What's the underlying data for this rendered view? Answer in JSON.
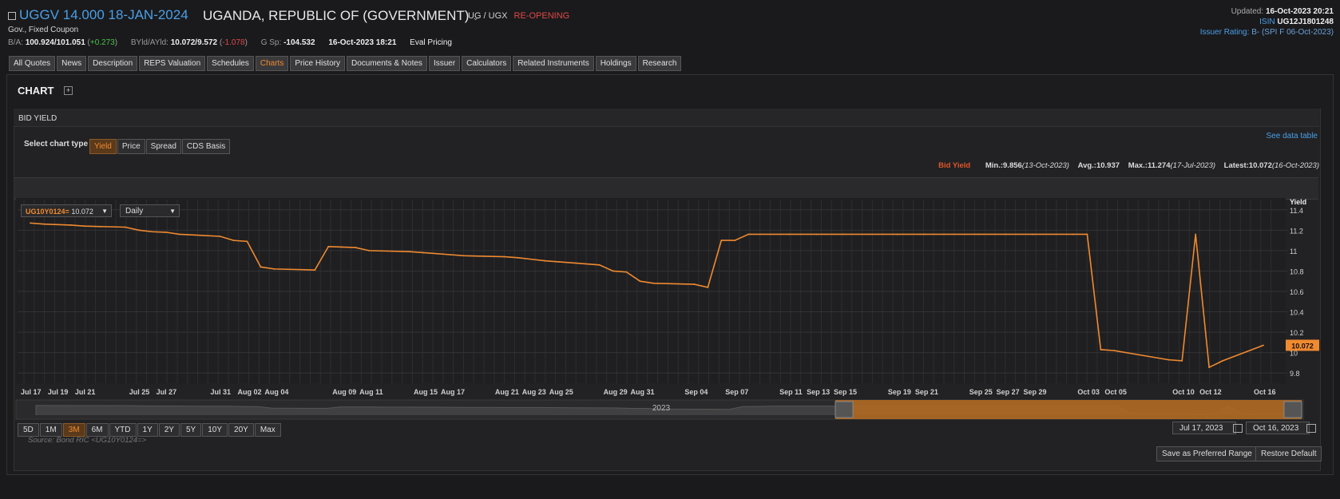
{
  "header": {
    "title": "UGGV 14.000 18-JAN-2024",
    "issuer": "UGANDA, REPUBLIC OF (GOVERNMENT)",
    "exchange": "UG / UGX",
    "status": "RE-OPENING",
    "subtype": "Gov., Fixed Coupon",
    "ba_label": "B/A:",
    "ba_value": "100.924/101.051",
    "ba_change": "+0.273",
    "byld_label": "BYld/AYld:",
    "byld_value": "10.072/9.572",
    "byld_change": "-1.078",
    "gsp_label": "G Sp:",
    "gsp_value": "-104.532",
    "quote_time": "16-Oct-2023 18:21",
    "pricing": "Eval Pricing",
    "updated_label": "Updated:",
    "updated_value": "16-Oct-2023 20:21",
    "isin_label": "ISIN",
    "isin_value": "UG12J1801248",
    "rating_label": "Issuer Rating:",
    "rating_value": "B- (SPI F 06-Oct-2023)"
  },
  "tabs": [
    "All Quotes",
    "News",
    "Description",
    "REPS Valuation",
    "Schedules",
    "Charts",
    "Price History",
    "Documents & Notes",
    "Issuer",
    "Calculators",
    "Related Instruments",
    "Holdings",
    "Research"
  ],
  "active_tab": "Charts",
  "chart_section": {
    "title": "CHART",
    "plus": "+",
    "panel_title": "BID YIELD",
    "see_data_table": "See data table",
    "chart_type_label": "Select chart type",
    "chart_types": [
      "Yield",
      "Price",
      "Spread",
      "CDS Basis"
    ],
    "active_chart_type": "Yield",
    "stats": {
      "label": "Bid Yield",
      "min": "Min.:9.856",
      "min_date": "(13-Oct-2023)",
      "avg": "Avg.:10.937",
      "max": "Max.:11.274",
      "max_date": "(17-Jul-2023)",
      "latest": "Latest:10.072",
      "latest_date": "(16-Oct-2023)"
    },
    "ric": "UG10Y0124=",
    "ric_value": "10.072",
    "frequency": "Daily",
    "navigator_year": "2023",
    "ranges": [
      "5D",
      "1M",
      "3M",
      "6M",
      "YTD",
      "1Y",
      "2Y",
      "5Y",
      "10Y",
      "20Y",
      "Max"
    ],
    "active_range": "3M",
    "date_from": "Jul 17, 2023",
    "date_to": "Oct 16, 2023",
    "source": "Source: Bond RIC <UG10Y0124=>",
    "save_range": "Save as Preferred Range",
    "restore_default": "Restore Default",
    "accent_color": "#f08a30"
  },
  "chart_data": {
    "type": "line",
    "title": "",
    "ylabel": "Yield",
    "ylim": [
      9.7,
      11.5
    ],
    "yticks": [
      9.8,
      10.0,
      10.2,
      10.4,
      10.6,
      10.8,
      11.0,
      11.2,
      11.4
    ],
    "xticks": [
      "Jul 17",
      "Jul 19",
      "Jul 21",
      "Jul 25",
      "Jul 27",
      "Jul 31",
      "Aug 02",
      "Aug 04",
      "Aug 09",
      "Aug 11",
      "Aug 15",
      "Aug 17",
      "Aug 21",
      "Aug 23",
      "Aug 25",
      "Aug 29",
      "Aug 31",
      "Sep 04",
      "Sep 07",
      "Sep 11",
      "Sep 13",
      "Sep 15",
      "Sep 19",
      "Sep 21",
      "Sep 25",
      "Sep 27",
      "Sep 29",
      "Oct 03",
      "Oct 05",
      "Oct 10",
      "Oct 12",
      "Oct 16"
    ],
    "latest_label": "10.072",
    "series": [
      {
        "name": "UG10Y0124=",
        "color": "#f08a30",
        "points": [
          [
            "Jul 17",
            11.27
          ],
          [
            "Jul 18",
            11.26
          ],
          [
            "Jul 19",
            11.255
          ],
          [
            "Jul 20",
            11.25
          ],
          [
            "Jul 21",
            11.24
          ],
          [
            "Jul 24",
            11.23
          ],
          [
            "Jul 25",
            11.2
          ],
          [
            "Jul 26",
            11.185
          ],
          [
            "Jul 27",
            11.18
          ],
          [
            "Jul 28",
            11.16
          ],
          [
            "Jul 31",
            11.14
          ],
          [
            "Aug 01",
            11.1
          ],
          [
            "Aug 02",
            11.09
          ],
          [
            "Aug 03",
            10.84
          ],
          [
            "Aug 04",
            10.82
          ],
          [
            "Aug 07",
            10.81
          ],
          [
            "Aug 08",
            11.04
          ],
          [
            "Aug 09",
            11.035
          ],
          [
            "Aug 10",
            11.03
          ],
          [
            "Aug 11",
            11.0
          ],
          [
            "Aug 14",
            10.99
          ],
          [
            "Aug 15",
            10.98
          ],
          [
            "Aug 16",
            10.97
          ],
          [
            "Aug 17",
            10.96
          ],
          [
            "Aug 18",
            10.95
          ],
          [
            "Aug 21",
            10.94
          ],
          [
            "Aug 22",
            10.93
          ],
          [
            "Aug 23",
            10.915
          ],
          [
            "Aug 24",
            10.9
          ],
          [
            "Aug 25",
            10.89
          ],
          [
            "Aug 28",
            10.86
          ],
          [
            "Aug 29",
            10.8
          ],
          [
            "Aug 30",
            10.79
          ],
          [
            "Aug 31",
            10.7
          ],
          [
            "Sep 01",
            10.68
          ],
          [
            "Sep 04",
            10.67
          ],
          [
            "Sep 05",
            10.64
          ],
          [
            "Sep 06",
            11.1
          ],
          [
            "Sep 07",
            11.1
          ],
          [
            "Sep 08",
            11.16
          ],
          [
            "Sep 11",
            11.16
          ],
          [
            "Sep 13",
            11.16
          ],
          [
            "Sep 15",
            11.16
          ],
          [
            "Sep 19",
            11.16
          ],
          [
            "Sep 21",
            11.16
          ],
          [
            "Sep 25",
            11.16
          ],
          [
            "Sep 27",
            11.16
          ],
          [
            "Sep 29",
            11.16
          ],
          [
            "Oct 02",
            11.16
          ],
          [
            "Oct 03",
            11.16
          ],
          [
            "Oct 04",
            10.03
          ],
          [
            "Oct 05",
            10.02
          ],
          [
            "Oct 09",
            9.93
          ],
          [
            "Oct 10",
            9.92
          ],
          [
            "Oct 11",
            11.16
          ],
          [
            "Oct 12",
            9.856
          ],
          [
            "Oct 13",
            9.92
          ],
          [
            "Oct 16",
            10.072
          ]
        ]
      }
    ]
  }
}
